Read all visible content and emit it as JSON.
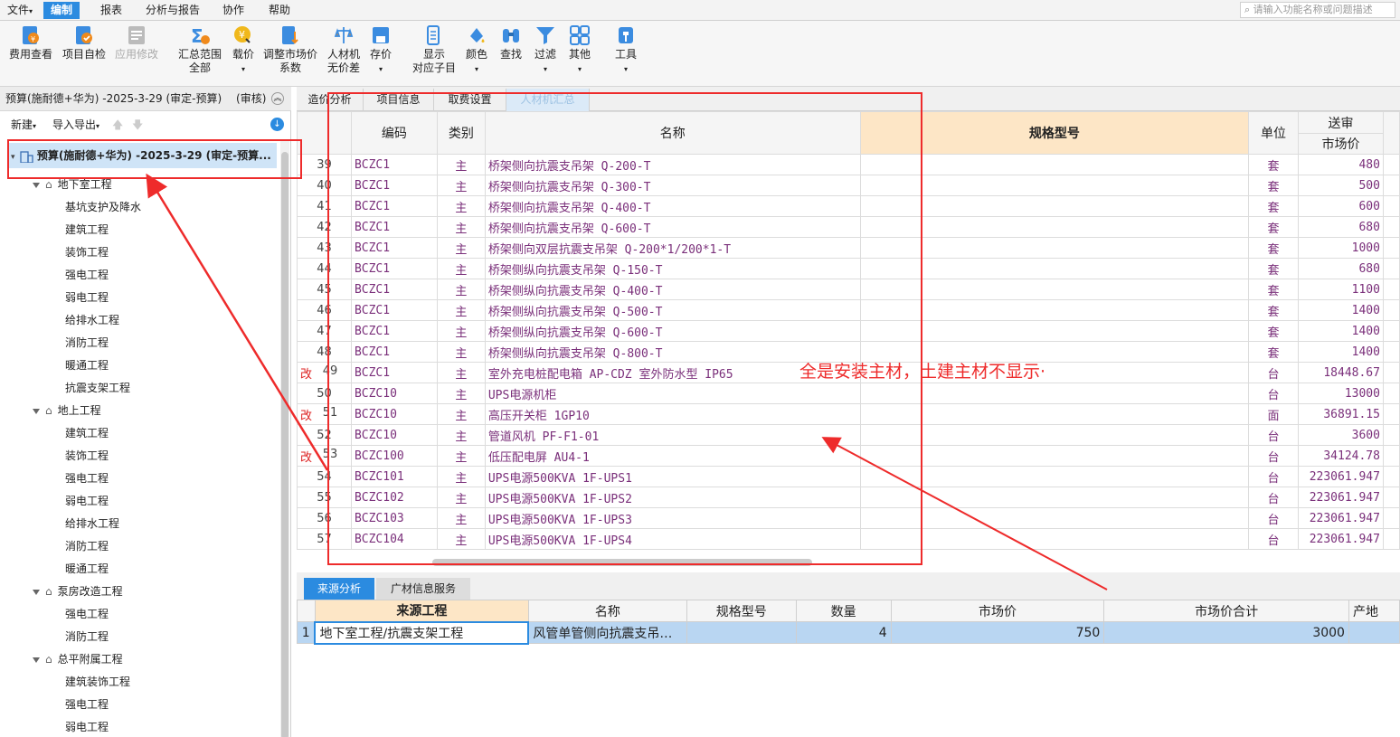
{
  "menubar": {
    "items": [
      "文件",
      "编制",
      "报表",
      "分析与报告",
      "协作",
      "帮助"
    ],
    "search_placeholder": "请输入功能名称或问题描述"
  },
  "toolbar": {
    "buttons": [
      {
        "label": "费用查看",
        "icon": "fee-view-icon"
      },
      {
        "label": "项目自检",
        "icon": "self-check-icon"
      },
      {
        "label": "应用修改",
        "icon": "apply-modify-icon"
      },
      {
        "label": "汇总范围",
        "label2": "全部",
        "icon": "summary-range-icon"
      },
      {
        "label": "载价",
        "icon": "load-price-icon"
      },
      {
        "label": "调整市场价",
        "label2": "系数",
        "icon": "adjust-price-icon"
      },
      {
        "label": "人材机",
        "label2": "无价差",
        "icon": "scale-icon"
      },
      {
        "label": "存价",
        "icon": "save-price-icon"
      },
      {
        "label": "显示",
        "label2": "对应子目",
        "icon": "show-item-icon"
      },
      {
        "label": "颜色",
        "icon": "color-icon"
      },
      {
        "label": "查找",
        "icon": "binoculars-icon"
      },
      {
        "label": "过滤",
        "icon": "filter-icon"
      },
      {
        "label": "其他",
        "icon": "grid-icon"
      },
      {
        "label": "工具",
        "icon": "tools-icon"
      }
    ]
  },
  "left": {
    "project_title": "预算(施耐德+华为) -2025-3-29 (审定-预算)",
    "review_label": "(审核)",
    "new_label": "新建",
    "import_label": "导入导出",
    "root": "预算(施耐德+华为) -2025-3-29 (审定-预算...",
    "groups": [
      {
        "name": "地下室工程",
        "children": [
          "基坑支护及降水",
          "建筑工程",
          "装饰工程",
          "强电工程",
          "弱电工程",
          "给排水工程",
          "消防工程",
          "暖通工程",
          "抗震支架工程"
        ]
      },
      {
        "name": "地上工程",
        "children": [
          "建筑工程",
          "装饰工程",
          "强电工程",
          "弱电工程",
          "给排水工程",
          "消防工程",
          "暖通工程"
        ]
      },
      {
        "name": "泵房改造工程",
        "children": [
          "强电工程",
          "消防工程"
        ]
      },
      {
        "name": "总平附属工程",
        "children": [
          "建筑装饰工程",
          "强电工程",
          "弱电工程"
        ]
      }
    ]
  },
  "tabs": [
    "造价分析",
    "项目信息",
    "取费设置",
    "人材机汇总"
  ],
  "grid": {
    "headers": {
      "code": "编码",
      "type": "类别",
      "name": "名称",
      "spec": "规格型号",
      "unit": "单位",
      "group": "送审",
      "price": "市场价"
    },
    "rows": [
      {
        "mark": "",
        "no": "39",
        "code": "BCZC1",
        "type": "主",
        "name": "桥架侧向抗震支吊架 Q-200-T",
        "unit": "套",
        "price": "480"
      },
      {
        "mark": "",
        "no": "40",
        "code": "BCZC1",
        "type": "主",
        "name": "桥架侧向抗震支吊架 Q-300-T",
        "unit": "套",
        "price": "500"
      },
      {
        "mark": "",
        "no": "41",
        "code": "BCZC1",
        "type": "主",
        "name": "桥架侧向抗震支吊架 Q-400-T",
        "unit": "套",
        "price": "600"
      },
      {
        "mark": "",
        "no": "42",
        "code": "BCZC1",
        "type": "主",
        "name": "桥架侧向抗震支吊架 Q-600-T",
        "unit": "套",
        "price": "680"
      },
      {
        "mark": "",
        "no": "43",
        "code": "BCZC1",
        "type": "主",
        "name": "桥架侧向双层抗震支吊架 Q-200*1/200*1-T",
        "unit": "套",
        "price": "1000"
      },
      {
        "mark": "",
        "no": "44",
        "code": "BCZC1",
        "type": "主",
        "name": "桥架侧纵向抗震支吊架 Q-150-T",
        "unit": "套",
        "price": "680"
      },
      {
        "mark": "",
        "no": "45",
        "code": "BCZC1",
        "type": "主",
        "name": "桥架侧纵向抗震支吊架 Q-400-T",
        "unit": "套",
        "price": "1100"
      },
      {
        "mark": "",
        "no": "46",
        "code": "BCZC1",
        "type": "主",
        "name": "桥架侧纵向抗震支吊架 Q-500-T",
        "unit": "套",
        "price": "1400"
      },
      {
        "mark": "",
        "no": "47",
        "code": "BCZC1",
        "type": "主",
        "name": "桥架侧纵向抗震支吊架 Q-600-T",
        "unit": "套",
        "price": "1400"
      },
      {
        "mark": "",
        "no": "48",
        "code": "BCZC1",
        "type": "主",
        "name": "桥架侧纵向抗震支吊架 Q-800-T",
        "unit": "套",
        "price": "1400"
      },
      {
        "mark": "改",
        "no": "49",
        "code": "BCZC1",
        "type": "主",
        "name": "室外充电桩配电箱 AP-CDZ 室外防水型 IP65",
        "unit": "台",
        "price": "18448.67"
      },
      {
        "mark": "",
        "no": "50",
        "code": "BCZC10",
        "type": "主",
        "name": "UPS电源机柜",
        "unit": "台",
        "price": "13000"
      },
      {
        "mark": "改",
        "no": "51",
        "code": "BCZC10",
        "type": "主",
        "name": "高压开关柜 1GP10",
        "unit": "面",
        "price": "36891.15"
      },
      {
        "mark": "",
        "no": "52",
        "code": "BCZC10",
        "type": "主",
        "name": "管道风机 PF-F1-01",
        "unit": "台",
        "price": "3600"
      },
      {
        "mark": "改",
        "no": "53",
        "code": "BCZC100",
        "type": "主",
        "name": "低压配电屏 AU4-1",
        "unit": "台",
        "price": "34124.78"
      },
      {
        "mark": "",
        "no": "54",
        "code": "BCZC101",
        "type": "主",
        "name": "UPS电源500KVA 1F-UPS1",
        "unit": "台",
        "price": "223061.947"
      },
      {
        "mark": "",
        "no": "55",
        "code": "BCZC102",
        "type": "主",
        "name": "UPS电源500KVA 1F-UPS2",
        "unit": "台",
        "price": "223061.947"
      },
      {
        "mark": "",
        "no": "56",
        "code": "BCZC103",
        "type": "主",
        "name": "UPS电源500KVA 1F-UPS3",
        "unit": "台",
        "price": "223061.947"
      },
      {
        "mark": "",
        "no": "57",
        "code": "BCZC104",
        "type": "主",
        "name": "UPS电源500KVA 1F-UPS4",
        "unit": "台",
        "price": "223061.947"
      }
    ]
  },
  "annotation": "全是安装主材，土建主材不显示·",
  "bottom": {
    "tabs": [
      "来源分析",
      "广材信息服务"
    ],
    "headers": [
      "来源工程",
      "名称",
      "规格型号",
      "数量",
      "市场价",
      "市场价合计",
      "产地"
    ],
    "row": {
      "no": "1",
      "source": "地下室工程/抗震支架工程",
      "name": "风管单管侧向抗震支吊…",
      "spec": "",
      "qty": "4",
      "price": "750",
      "total": "3000"
    }
  },
  "colors": {
    "accent": "#2b8be0",
    "annotation": "#ee2b2b",
    "selected_row": "#cfe2f6",
    "material_text": "#7a2f7a"
  }
}
